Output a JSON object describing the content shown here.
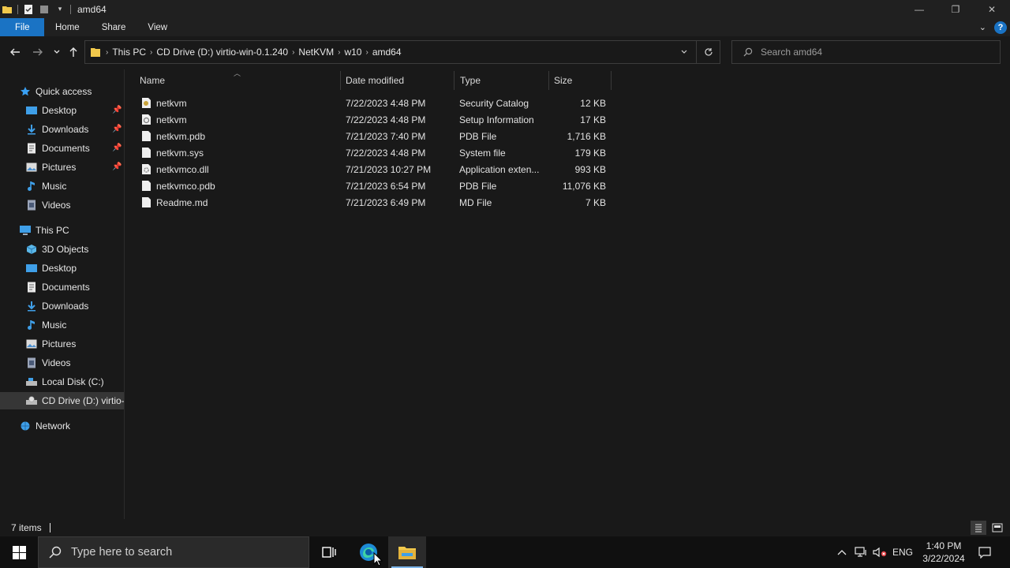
{
  "window": {
    "title": "amd64",
    "minimize_glyph": "—",
    "restore_glyph": "❐",
    "close_glyph": "✕"
  },
  "ribbon": {
    "tabs": [
      "File",
      "Home",
      "Share",
      "View"
    ]
  },
  "address": {
    "crumbs": [
      "This PC",
      "CD Drive (D:) virtio-win-0.1.240",
      "NetKVM",
      "w10",
      "amd64"
    ]
  },
  "search": {
    "placeholder": "Search amd64"
  },
  "nav": {
    "quick_access": "Quick access",
    "quick_items": [
      {
        "label": "Desktop",
        "icon": "desktop-icon",
        "pinned": true
      },
      {
        "label": "Downloads",
        "icon": "downloads-icon",
        "pinned": true
      },
      {
        "label": "Documents",
        "icon": "documents-icon",
        "pinned": true
      },
      {
        "label": "Pictures",
        "icon": "pictures-icon",
        "pinned": true
      },
      {
        "label": "Music",
        "icon": "music-icon",
        "pinned": false
      },
      {
        "label": "Videos",
        "icon": "videos-icon",
        "pinned": false
      }
    ],
    "this_pc": "This PC",
    "pc_items": [
      {
        "label": "3D Objects",
        "icon": "3d-objects-icon"
      },
      {
        "label": "Desktop",
        "icon": "desktop-icon"
      },
      {
        "label": "Documents",
        "icon": "documents-icon"
      },
      {
        "label": "Downloads",
        "icon": "downloads-icon"
      },
      {
        "label": "Music",
        "icon": "music-icon"
      },
      {
        "label": "Pictures",
        "icon": "pictures-icon"
      },
      {
        "label": "Videos",
        "icon": "videos-icon"
      },
      {
        "label": "Local Disk (C:)",
        "icon": "local-disk-icon"
      },
      {
        "label": "CD Drive (D:) virtio-",
        "icon": "cd-drive-icon",
        "selected": true
      }
    ],
    "network": "Network"
  },
  "files": {
    "columns": [
      "Name",
      "Date modified",
      "Type",
      "Size"
    ],
    "rows": [
      {
        "name": "netkvm",
        "date": "7/22/2023 4:48 PM",
        "type": "Security Catalog",
        "size": "12 KB",
        "icon": "security-catalog-icon"
      },
      {
        "name": "netkvm",
        "date": "7/22/2023 4:48 PM",
        "type": "Setup Information",
        "size": "17 KB",
        "icon": "setup-information-icon"
      },
      {
        "name": "netkvm.pdb",
        "date": "7/21/2023 7:40 PM",
        "type": "PDB File",
        "size": "1,716 KB",
        "icon": "file-icon"
      },
      {
        "name": "netkvm.sys",
        "date": "7/22/2023 4:48 PM",
        "type": "System file",
        "size": "179 KB",
        "icon": "file-icon"
      },
      {
        "name": "netkvmco.dll",
        "date": "7/21/2023 10:27 PM",
        "type": "Application exten...",
        "size": "993 KB",
        "icon": "dll-icon"
      },
      {
        "name": "netkvmco.pdb",
        "date": "7/21/2023 6:54 PM",
        "type": "PDB File",
        "size": "11,076 KB",
        "icon": "file-icon"
      },
      {
        "name": "Readme.md",
        "date": "7/21/2023 6:49 PM",
        "type": "MD File",
        "size": "7 KB",
        "icon": "file-icon"
      }
    ]
  },
  "status": {
    "count": "7 items"
  },
  "taskbar": {
    "search_placeholder": "Type here to search",
    "lang": "ENG",
    "time": "1:40 PM",
    "date": "3/22/2024"
  },
  "colors": {
    "accent": "#1a73c4",
    "folder": "#f2c94c"
  }
}
